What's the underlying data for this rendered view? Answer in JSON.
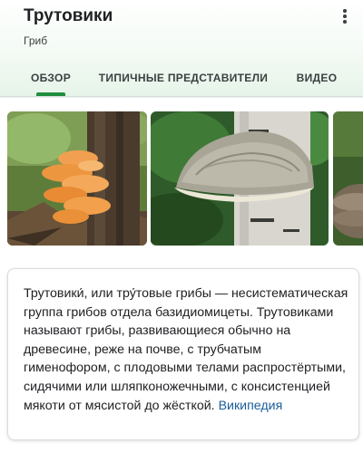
{
  "header": {
    "title": "Трутовики",
    "subtitle": "Гриб",
    "menu_icon": "more-vert-icon"
  },
  "tabs": [
    {
      "label": "ОБЗОР",
      "selected": true
    },
    {
      "label": "ТИПИЧНЫЕ ПРЕДСТАВИТЕЛИ",
      "selected": false
    },
    {
      "label": "ВИДЕО",
      "selected": false
    }
  ],
  "colors": {
    "accent": "#1e8e3e",
    "link": "#1a5e9c",
    "header_tint": "#e6f4e8"
  },
  "gallery": [
    {
      "subject": "orange shelf fungus on tree trunk"
    },
    {
      "subject": "grey bracket fungus on birch trunk"
    },
    {
      "subject": "partial image of fungus on log"
    }
  ],
  "description": {
    "text": "Трутовики́, или тру́товые грибы — несистематическая группа грибов отдела базидиомицеты. Трутовиками называют грибы, развивающиеся обычно на древесине, реже на почве, с трубчатым гименофором, с плодовыми телами распростёртыми, сидячими или шляпконожечными, с консистенцией мякоти от мясистой до жёсткой.",
    "source_link": "Википедия"
  }
}
